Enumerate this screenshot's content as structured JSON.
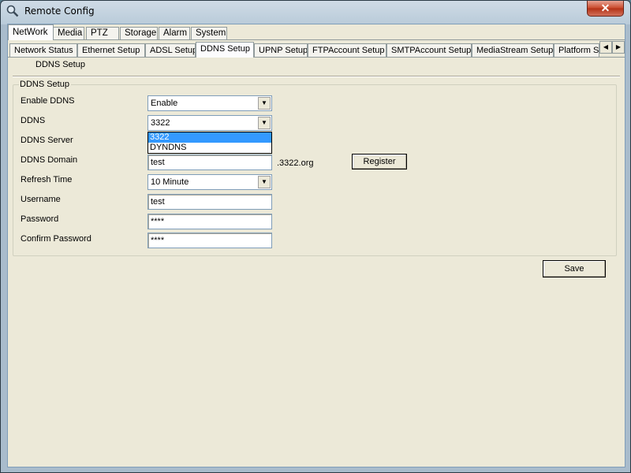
{
  "window": {
    "title": "Remote Config",
    "close_label": "✕"
  },
  "top_tabs": [
    "NetWork",
    "Media",
    "PTZ",
    "Storage",
    "Alarm",
    "System"
  ],
  "sub_tabs": [
    "Network Status",
    "Ethernet Setup",
    "ADSL Setup",
    "DDNS Setup",
    "UPNP Setup",
    "FTPAccount Setup",
    "SMTPAccount Setup",
    "MediaStream Setup",
    "Platform Se"
  ],
  "scroll_arrows": {
    "left": "◀",
    "right": "▶"
  },
  "page": {
    "subheader": "DDNS Setup",
    "group_title": "DDNS Setup"
  },
  "form": {
    "enable_label": "Enable DDNS",
    "enable_value": "Enable",
    "ddns_label": "DDNS",
    "ddns_value": "3322",
    "ddns_options": [
      "3322",
      "DYNDNS"
    ],
    "server_label": "DDNS Server",
    "domain_label": "DDNS Domain",
    "domain_value": "test",
    "domain_suffix": ".3322.org",
    "refresh_label": "Refresh Time",
    "refresh_value": "10 Minute",
    "username_label": "Username",
    "username_value": "test",
    "password_label": "Password",
    "password_value": "****",
    "confirm_label": "Confirm Password",
    "confirm_value": "****"
  },
  "buttons": {
    "register": "Register",
    "save": "Save"
  },
  "icons": {
    "app": "app-search-icon",
    "combo_arrow": "▼"
  }
}
